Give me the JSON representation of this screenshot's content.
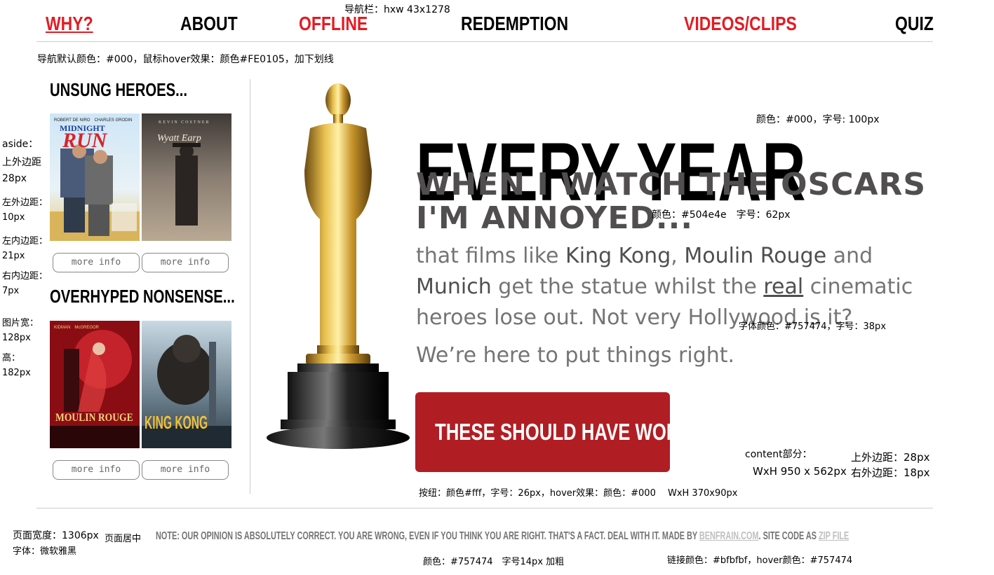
{
  "annotations": {
    "nav_bar": "导航栏：hxw 43x1278",
    "nav_style": "导航默认颜色：#000，鼠标hover效果：颜色#FE0105，加下划线",
    "aside_title": "aside：",
    "aside_margin_top_label": "上外边距",
    "aside_margin_top_value": "28px",
    "aside_margin_left_label": "左外边距：",
    "aside_margin_left_value": "10px",
    "aside_padding_left_label": "左内边距：",
    "aside_padding_left_value": "21px",
    "aside_padding_right_label": "右内边距：",
    "aside_padding_right_value": "7px",
    "img_width_label": "图片宽：",
    "img_width_value": "128px",
    "img_height_label": "高：",
    "img_height_value": "182px",
    "every_year_style": "颜色：#000，字号: 100px",
    "subhead_style": "颜色：#504e4e　字号：62px",
    "body_style": "字体颜色：#757474，字号：38px",
    "content_label": "content部分：",
    "content_size": "WxH 950 x 562px",
    "content_margin_top": "上外边距：28px",
    "content_margin_right": "右外边距：18px",
    "button_style": "按纽：颜色#fff，字号：26px，hover效果：颜色：#000　 WxH 370x90px",
    "page_width": "页面宽度：1306px",
    "page_center": "页面居中",
    "font_note": "字体：微软雅黑",
    "footer_color_note": "颜色：#757474　字号14px 加粗",
    "link_color_note": "链接颜色：#bfbfbf，hover颜色：#757474"
  },
  "nav": {
    "items": [
      "WHY?",
      "ABOUT",
      "OFFLINE",
      "REDEMPTION",
      "VIDEOS/CLIPS",
      "QUIZ"
    ]
  },
  "aside": {
    "section1_title": "UNSUNG HEROES...",
    "section2_title": "OVERHYPED NONSENSE...",
    "more_info": "more info",
    "posters": [
      {
        "title_line1": "MIDNIGHT",
        "title_line2": "RUN",
        "actors": "ROBERT DE NIRO　CHARLES GRODIN"
      },
      {
        "title": "Wyatt Earp",
        "actors": "KEVIN COSTNER"
      },
      {
        "title_line1": "MOULIN ROUGE",
        "actors": "KIDMAN　McGREGOR"
      },
      {
        "title": "KING KONG"
      }
    ]
  },
  "content": {
    "headline": "EVERY YEAR",
    "subhead": "WHEN I WATCH THE OSCARS I'M ANNOYED...",
    "p1_a": "that films like ",
    "p1_b": "King Kong",
    "p1_c": ", ",
    "p1_d": "Moulin Rouge",
    "p1_e": " and ",
    "p1_f": "Munich",
    "p1_g": " get the statue whilst the ",
    "p1_h": "real",
    "p1_i": " cinematic heroes lose out. Not very Hollywood is it?",
    "p2": "We’re here to put things right.",
    "cta": "THESE SHOULD HAVE WON ››"
  },
  "footer": {
    "text_a": "NOTE: OUR OPINION IS ABSOLUTELY CORRECT. YOU ARE WRONG, EVEN IF YOU THINK YOU ARE RIGHT. THAT'S A FACT. DEAL WITH IT. MADE BY ",
    "link1": "BENFRAIN.COM",
    "text_b": ". SITE CODE AS ",
    "link2": "ZIP FILE"
  },
  "colors": {
    "nav_red": "#e31b23",
    "subhead": "#504e4e",
    "body": "#757474",
    "cta_bg": "#b01e24",
    "link": "#bfbfbf"
  }
}
